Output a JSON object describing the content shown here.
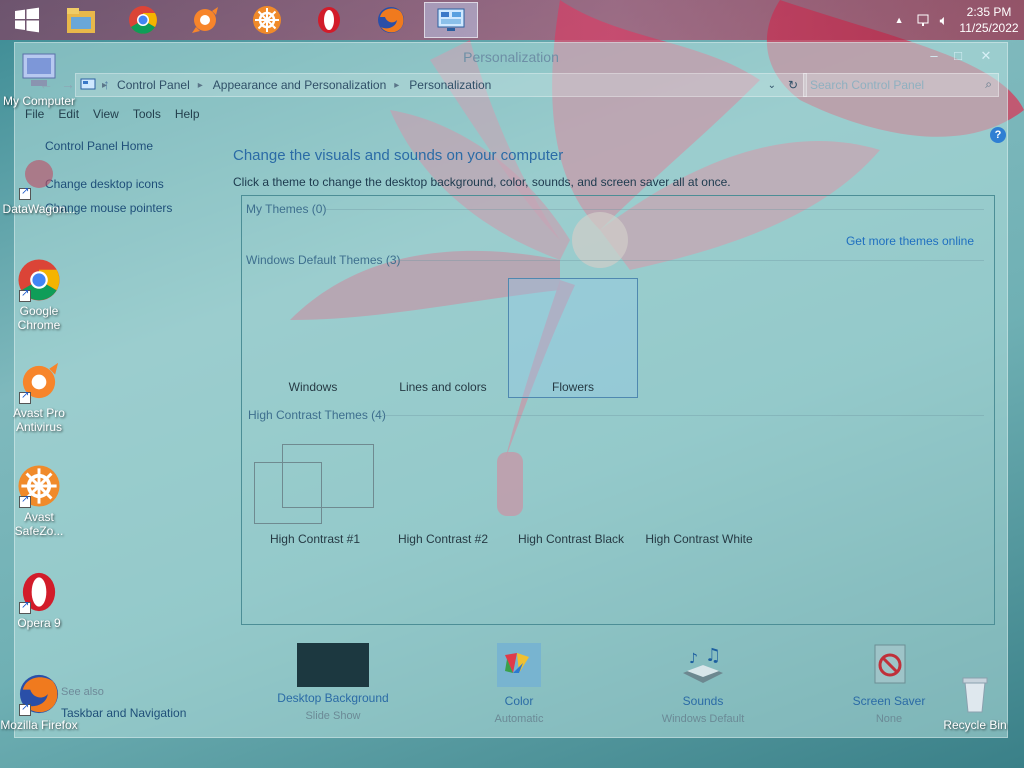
{
  "taskbar": {
    "apps": [
      "start-button",
      "file-explorer",
      "chrome",
      "avast",
      "safezone",
      "opera",
      "firefox",
      "control-panel"
    ],
    "clock_time": "2:35 PM",
    "clock_date": "11/25/2022"
  },
  "window": {
    "title": "Personalization",
    "address": {
      "crumbs": [
        "Control Panel",
        "Appearance and Personalization",
        "Personalization"
      ]
    },
    "search_placeholder": "Search Control Panel",
    "menu": [
      "File",
      "Edit",
      "View",
      "Tools",
      "Help"
    ],
    "left_pane": {
      "home": "Control Panel Home",
      "links": [
        "Change desktop icons",
        "Change mouse pointers"
      ],
      "see_also_title": "See also",
      "see_also_links": [
        "Taskbar and Navigation"
      ]
    },
    "heading": "Change the visuals and sounds on your computer",
    "subheading": "Click a theme to change the desktop background, color, sounds, and screen saver all at once.",
    "themes": {
      "my_themes_title": "My Themes (0)",
      "get_more": "Get more themes online",
      "default_title": "Windows Default Themes (3)",
      "default_themes": [
        "Windows",
        "Lines and colors",
        "Flowers"
      ],
      "high_contrast_title": "High Contrast Themes (4)",
      "high_contrast_themes": [
        "High Contrast #1",
        "High Contrast #2",
        "High Contrast Black",
        "High Contrast White"
      ]
    },
    "bottom": [
      {
        "label": "Desktop Background",
        "value": "Slide Show"
      },
      {
        "label": "Color",
        "value": "Automatic"
      },
      {
        "label": "Sounds",
        "value": "Windows Default"
      },
      {
        "label": "Screen Saver",
        "value": "None"
      }
    ]
  },
  "desktop_icons": [
    {
      "label": "My Computer"
    },
    {
      "label": "DataWagon..."
    },
    {
      "label": "Google Chrome"
    },
    {
      "label": "Avast Pro Antivirus"
    },
    {
      "label": "Avast SafeZo..."
    },
    {
      "label": "Opera 9"
    },
    {
      "label": "Mozilla Firefox"
    },
    {
      "label": "Recycle Bin"
    }
  ]
}
